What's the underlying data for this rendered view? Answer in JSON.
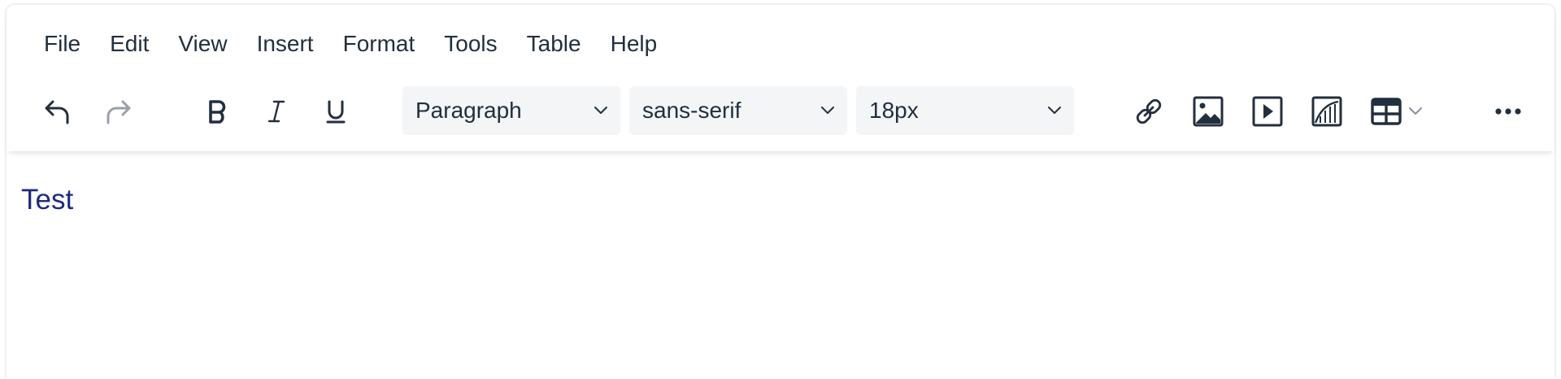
{
  "menubar": {
    "items": [
      "File",
      "Edit",
      "View",
      "Insert",
      "Format",
      "Tools",
      "Table",
      "Help"
    ]
  },
  "toolbar": {
    "undo_icon": "undo-icon",
    "redo_icon": "redo-icon",
    "redo_disabled": true,
    "bold_icon": "bold-icon",
    "italic_icon": "italic-icon",
    "underline_icon": "underline-icon",
    "block_format": "Paragraph",
    "font_family": "sans-serif",
    "font_size": "18px",
    "link_icon": "link-icon",
    "image_icon": "image-icon",
    "media_icon": "media-icon",
    "chart_icon": "chart-icon",
    "table_icon": "table-icon",
    "more_icon": "more-icon"
  },
  "content": {
    "paragraph": "Test"
  },
  "colors": {
    "icon": "#222f3e",
    "icon_disabled": "#99a0a8",
    "content_text": "#1f2b7a",
    "select_bg": "#f4f5f7"
  }
}
